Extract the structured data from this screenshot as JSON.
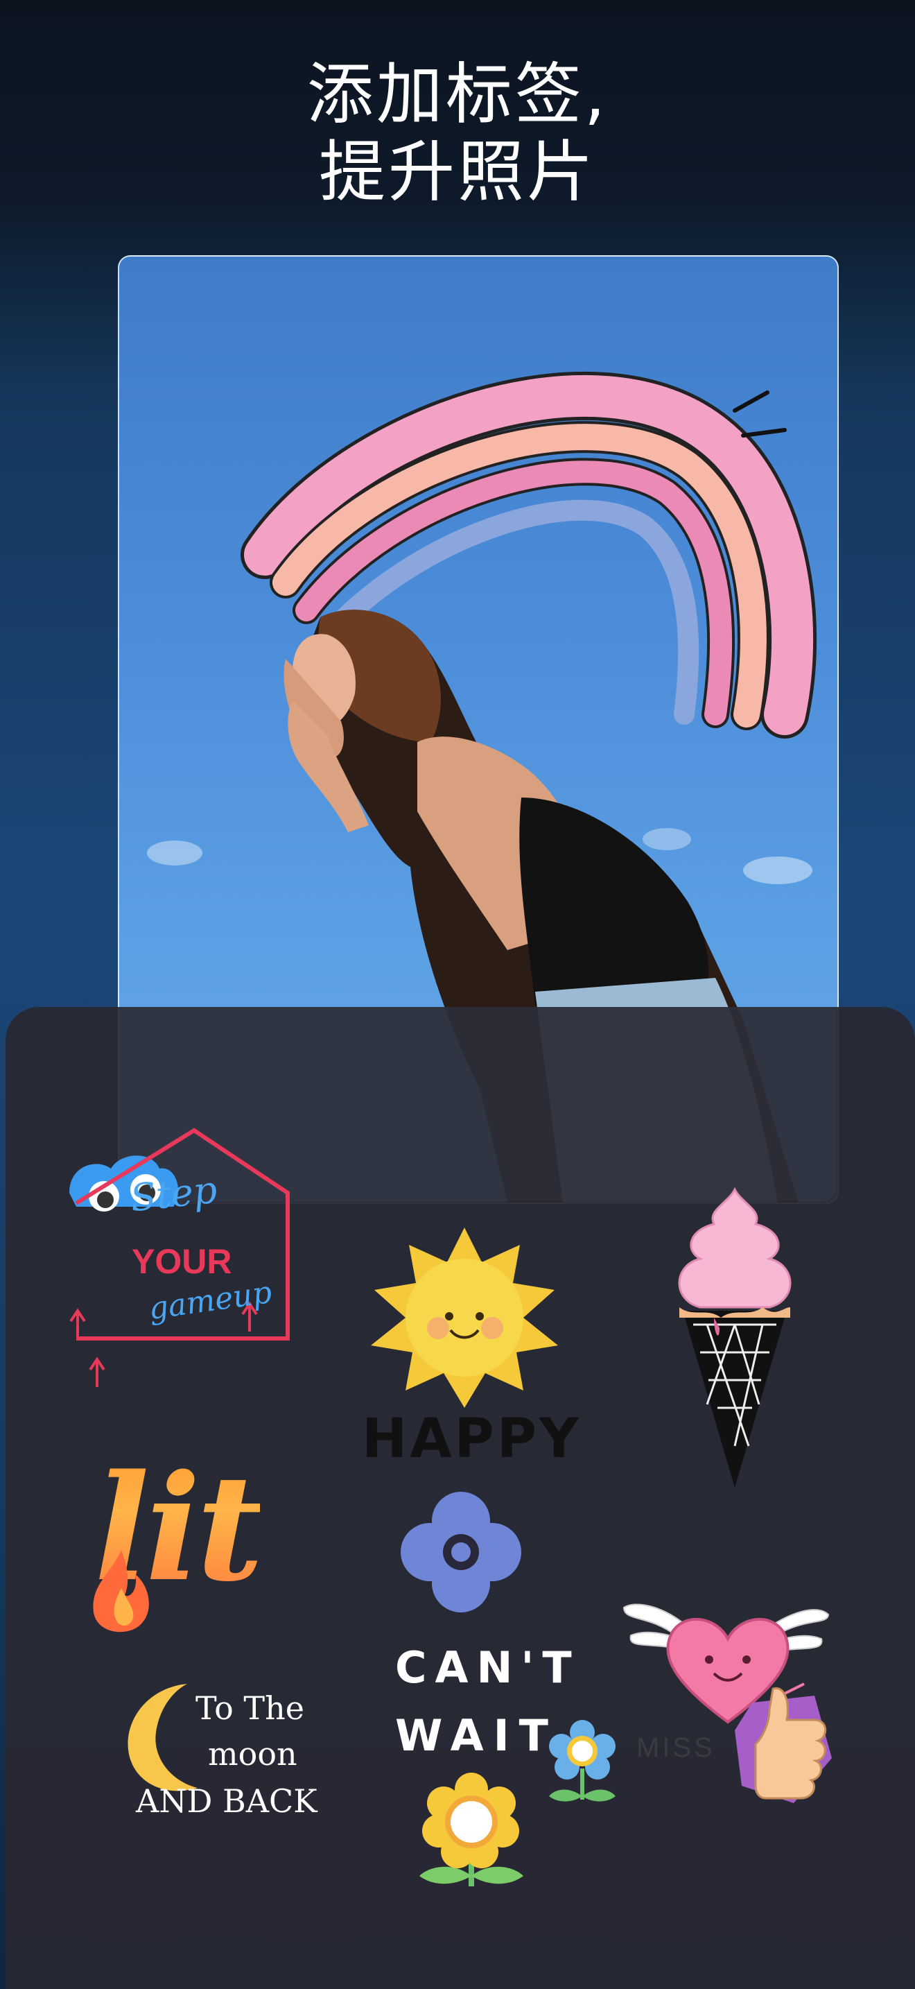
{
  "headline": {
    "line1": "添加标签,",
    "line2": "提升照片"
  },
  "stickers": {
    "step": "Step",
    "your": "YOUR",
    "gameup": "gameup",
    "happy": "HAPPY",
    "lit": "lit",
    "cant": "CAN'T",
    "wait": "WAIT",
    "moon_line1": "To The",
    "moon_line2": "moon",
    "moon_line3": "AND BACK",
    "miss": "MISS"
  },
  "colors": {
    "sky": "#4c8dd9",
    "panel": "#28283a",
    "rainbow_pink": "#f3a2c6",
    "rainbow_peach": "#f7b8a8",
    "rainbow_blue": "#8aa6dc",
    "sun": "#f5c93a",
    "flower_blue": "#6f86d6",
    "accent_red": "#e8395a",
    "accent_blue": "#4aa6f2"
  },
  "icons": [
    "rainbow-sticker",
    "sun-sticker",
    "ice-cream-sticker",
    "flower-sticker",
    "heart-wings-sticker",
    "thumbs-up-sticker",
    "moon-sticker",
    "cloud-eyes-sticker",
    "fire-sticker"
  ]
}
